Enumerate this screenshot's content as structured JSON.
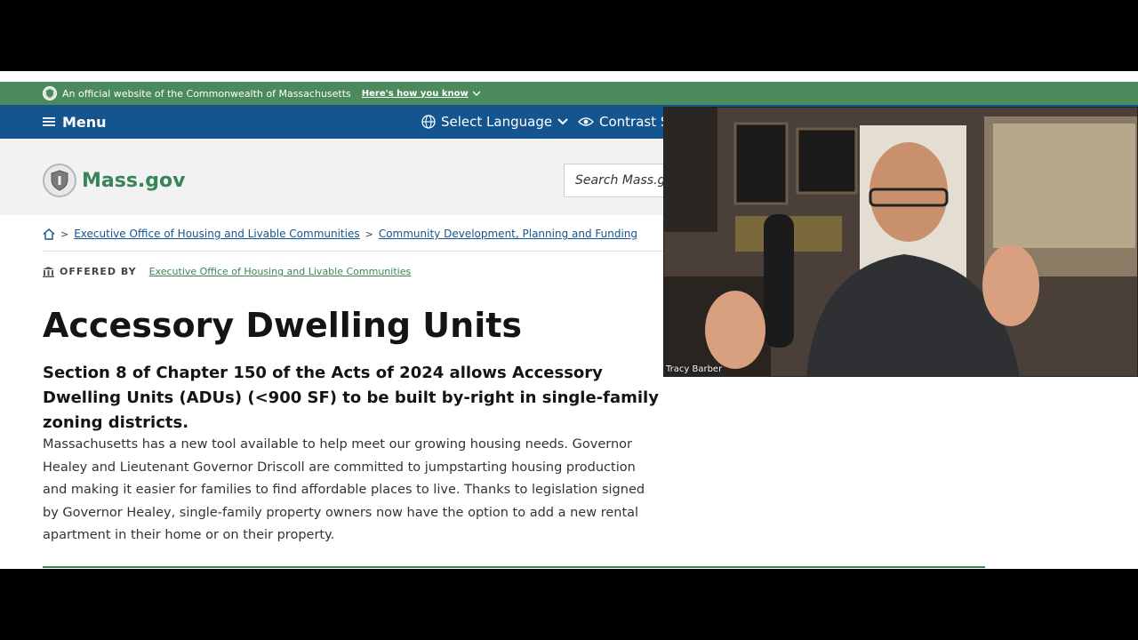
{
  "gov_banner": {
    "official_text": "An official website of the Commonwealth of Massachusetts",
    "how_link": "Here's how you know"
  },
  "nav": {
    "menu_label": "Menu",
    "language_label": "Select Language",
    "contrast_label": "Contrast Se"
  },
  "header": {
    "logo_text": "Mass.gov",
    "search_placeholder": "Search Mass.gov"
  },
  "breadcrumb": {
    "items": [
      "Executive Office of Housing and Livable Communities",
      "Community Development, Planning and Funding"
    ]
  },
  "offered_by": {
    "label": "OFFERED BY",
    "org": "Executive Office of Housing and Livable Communities"
  },
  "main": {
    "title": "Accessory Dwelling Units",
    "subtitle": "Section 8 of Chapter 150 of the Acts of 2024 allows Accessory Dwelling Units (ADUs) (<900 SF) to be built by-right in single-family zoning districts.",
    "body": "Massachusetts has a new tool available to help meet our growing housing needs. Governor Healey and Lieutenant Governor Driscoll are committed to jumpstarting housing production and making it easier for families to find affordable places to live. Thanks to legislation signed by Governor Healey, single-family property owners now have the option to add a new rental apartment in their home or on their property."
  },
  "webcam": {
    "name": "Tracy Barber"
  },
  "colors": {
    "gov_green": "#4b8a5c",
    "nav_blue": "#14558f",
    "link_green": "#388557"
  }
}
